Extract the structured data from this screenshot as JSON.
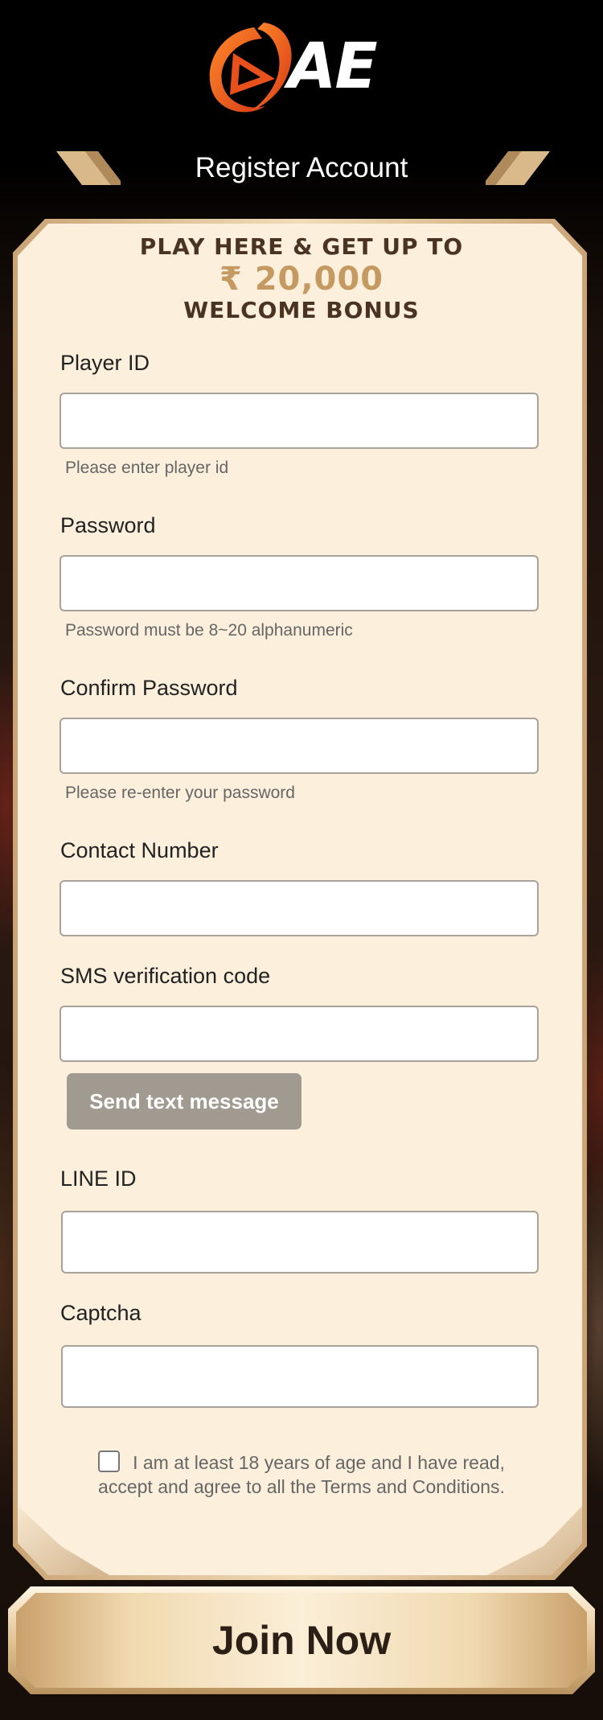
{
  "header": {
    "logo_text": "AE",
    "title": "Register Account"
  },
  "promo": {
    "line1": "PLAY HERE & GET UP TO",
    "amount": "₹ 20,000",
    "line3": "WELCOME BONUS"
  },
  "form": {
    "player_id": {
      "label": "Player ID",
      "value": "",
      "hint": "Please enter player id"
    },
    "password": {
      "label": "Password",
      "value": "",
      "hint": "Password must be 8~20 alphanumeric"
    },
    "confirm_password": {
      "label": "Confirm Password",
      "value": "",
      "hint": "Please re-enter your password"
    },
    "contact_number": {
      "label": "Contact Number",
      "value": ""
    },
    "sms_code": {
      "label": "SMS verification code",
      "value": ""
    },
    "send_sms_label": "Send text message",
    "line_id": {
      "label": "LINE ID",
      "value": ""
    },
    "captcha": {
      "label": "Captcha",
      "value": ""
    },
    "agree_text": "I am at least 18 years of age and I have read, accept and agree to all the Terms and Conditions.",
    "agree_checked": false
  },
  "join_label": "Join Now",
  "colors": {
    "accent_orange": "#f06a22",
    "gold": "#c49a62",
    "card_bg": "#fcefdc",
    "button_gray": "#a09a90"
  }
}
